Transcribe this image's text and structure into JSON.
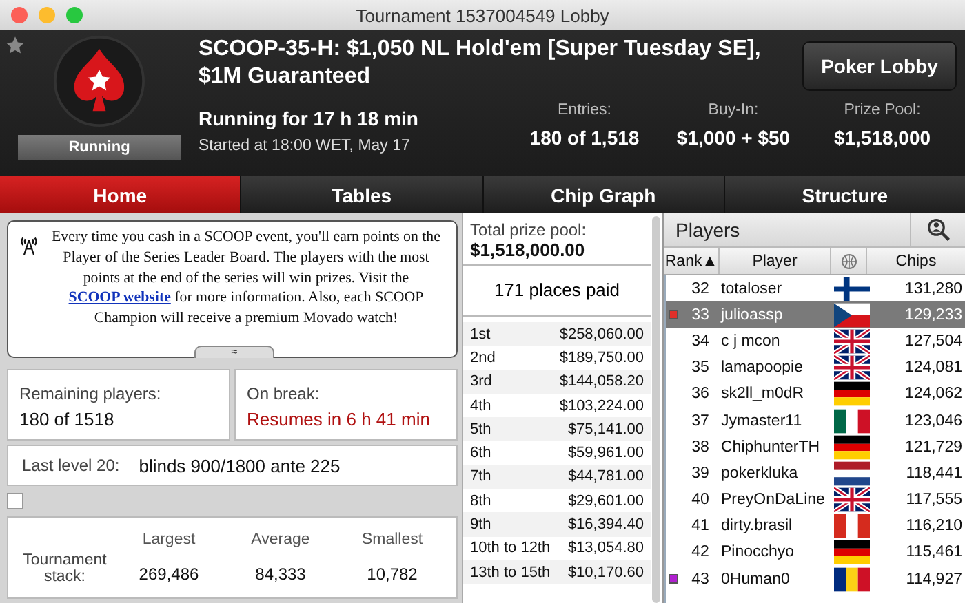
{
  "window": {
    "title": "Tournament 1537004549 Lobby"
  },
  "header": {
    "title": "SCOOP-35-H: $1,050 NL Hold'em [Super Tuesday SE], $1M Guaranteed",
    "status": "Running",
    "running_for": "Running for 17 h 18 min",
    "started": "Started at 18:00 WET, May 17",
    "stats": [
      {
        "label": "Entries:",
        "value": "180 of 1,518"
      },
      {
        "label": "Buy-In:",
        "value": "$1,000 + $50"
      },
      {
        "label": "Prize Pool:",
        "value": "$1,518,000"
      }
    ],
    "lobby_button": "Poker Lobby"
  },
  "tabs": [
    {
      "label": "Home",
      "selected": true
    },
    {
      "label": "Tables",
      "selected": false
    },
    {
      "label": "Chip Graph",
      "selected": false
    },
    {
      "label": "Structure",
      "selected": false
    }
  ],
  "info": {
    "text_before": "Every time you cash in a SCOOP event, you'll earn points on the Player of the Series Leader Board. The players with the most points at the end of the series will win prizes. Visit the",
    "link": "SCOOP website",
    "text_after": "for more information. Also, each SCOOP Champion will receive a premium Movado watch!",
    "collapse": "≈"
  },
  "remaining": {
    "label": "Remaining players:",
    "value": "180 of 1518"
  },
  "break": {
    "label": "On break:",
    "value": "Resumes in 6 h 41 min"
  },
  "last_level": {
    "label": "Last level 20:",
    "value": "blinds 900/1800 ante 225"
  },
  "show_checkbox": {
    "checked": false
  },
  "stack": {
    "label": "Tournament stack:",
    "columns": [
      {
        "label": "Largest",
        "value": "269,486"
      },
      {
        "label": "Average",
        "value": "84,333"
      },
      {
        "label": "Smallest",
        "value": "10,782"
      }
    ]
  },
  "prizes": {
    "total_label": "Total prize pool:",
    "total": "$1,518,000.00",
    "places": "171 places paid",
    "rows": [
      {
        "place": "1st",
        "amount": "$258,060.00"
      },
      {
        "place": "2nd",
        "amount": "$189,750.00"
      },
      {
        "place": "3rd",
        "amount": "$144,058.20"
      },
      {
        "place": "4th",
        "amount": "$103,224.00"
      },
      {
        "place": "5th",
        "amount": "$75,141.00"
      },
      {
        "place": "6th",
        "amount": "$59,961.00"
      },
      {
        "place": "7th",
        "amount": "$44,781.00"
      },
      {
        "place": "8th",
        "amount": "$29,601.00"
      },
      {
        "place": "9th",
        "amount": "$16,394.40"
      },
      {
        "place": "10th to 12th",
        "amount": "$13,054.80"
      },
      {
        "place": "13th to 15th",
        "amount": "$10,170.60"
      }
    ]
  },
  "players": {
    "title": "Players",
    "columns": [
      "Rank▲",
      "Player",
      "Chips"
    ],
    "rows": [
      {
        "rank": "32",
        "name": "totaloser",
        "kind": "fi",
        "chips": "131,280",
        "selected": false
      },
      {
        "rank": "33",
        "name": "julioassp",
        "kind": "cz",
        "chips": "129,233",
        "selected": true,
        "color": "#e0302a"
      },
      {
        "rank": "34",
        "name": "c j mcon",
        "kind": "gb",
        "chips": "127,504",
        "selected": false
      },
      {
        "rank": "35",
        "name": "lamapoopie",
        "kind": "gb",
        "chips": "124,081",
        "selected": false
      },
      {
        "rank": "36",
        "name": "sk2ll_m0dR",
        "kind": "de",
        "chips": "124,062",
        "selected": false
      },
      {
        "rank": "37",
        "name": "Jymaster11",
        "kind": "mx",
        "chips": "123,046",
        "selected": false
      },
      {
        "rank": "38",
        "name": "ChiphunterTH",
        "kind": "de",
        "chips": "121,729",
        "selected": false
      },
      {
        "rank": "39",
        "name": "pokerkluka",
        "kind": "nl",
        "chips": "118,441",
        "selected": false
      },
      {
        "rank": "40",
        "name": "PreyOnDaLine",
        "kind": "gb",
        "chips": "117,555",
        "selected": false
      },
      {
        "rank": "41",
        "name": "dirty.brasil",
        "kind": "ca",
        "chips": "116,210",
        "selected": false
      },
      {
        "rank": "42",
        "name": "Pinocchyo",
        "kind": "de",
        "chips": "115,461",
        "selected": false
      },
      {
        "rank": "43",
        "name": "0Human0",
        "kind": "ro",
        "chips": "114,927",
        "selected": false,
        "color": "#b020d0"
      }
    ]
  }
}
